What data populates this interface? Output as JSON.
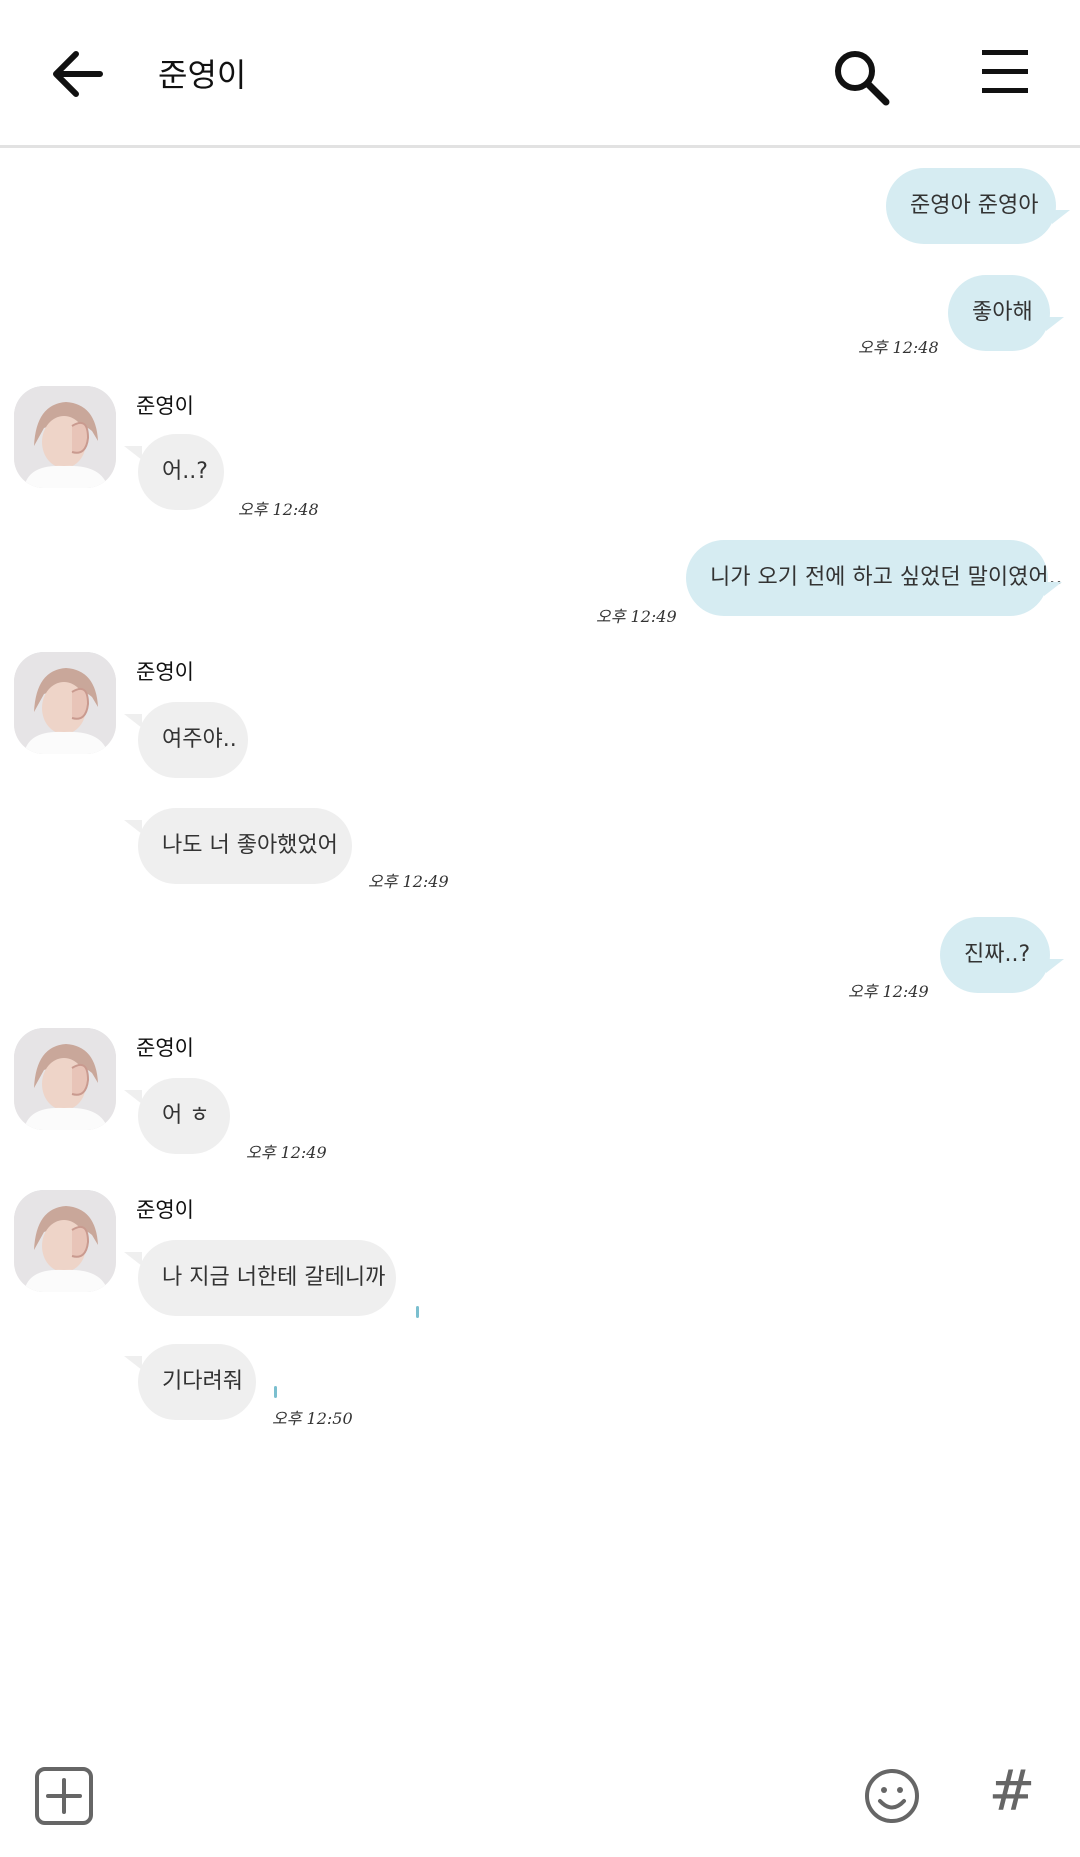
{
  "header": {
    "title": "준영이"
  },
  "icons": {
    "back": "arrow-left-icon",
    "search": "search-icon",
    "menu": "hamburger-menu-icon",
    "add": "plus-square-icon",
    "emoji": "smiley-icon",
    "hashtag": "hashtag-icon"
  },
  "colors": {
    "my_bubble": "#d6ecf2",
    "other_bubble": "#efefef",
    "divider": "#e2e2e2"
  },
  "messages": {
    "m1": {
      "text": "준영아 준영아"
    },
    "m2": {
      "text": "좋아해",
      "time": "오후 12:48"
    },
    "g1": {
      "sender": "준영이",
      "text": "어..?",
      "time": "오후 12:48"
    },
    "m3": {
      "text": "니가 오기 전에 하고 싶었던 말이였어..",
      "time": "오후 12:49"
    },
    "g2": {
      "sender": "준영이",
      "text1": "여주야..",
      "text2": "나도 너 좋아했었어",
      "time": "오후 12:49"
    },
    "m4": {
      "text": "진짜..?",
      "time": "오후 12:49"
    },
    "g3": {
      "sender": "준영이",
      "text": "어 ㅎ",
      "time": "오후 12:49"
    },
    "g4": {
      "sender": "준영이",
      "text1": "나 지금 너한테 갈테니까",
      "text2": "기다려줘",
      "time": "오후 12:50"
    }
  },
  "bottom_bar": {
    "hash_label": "#"
  }
}
